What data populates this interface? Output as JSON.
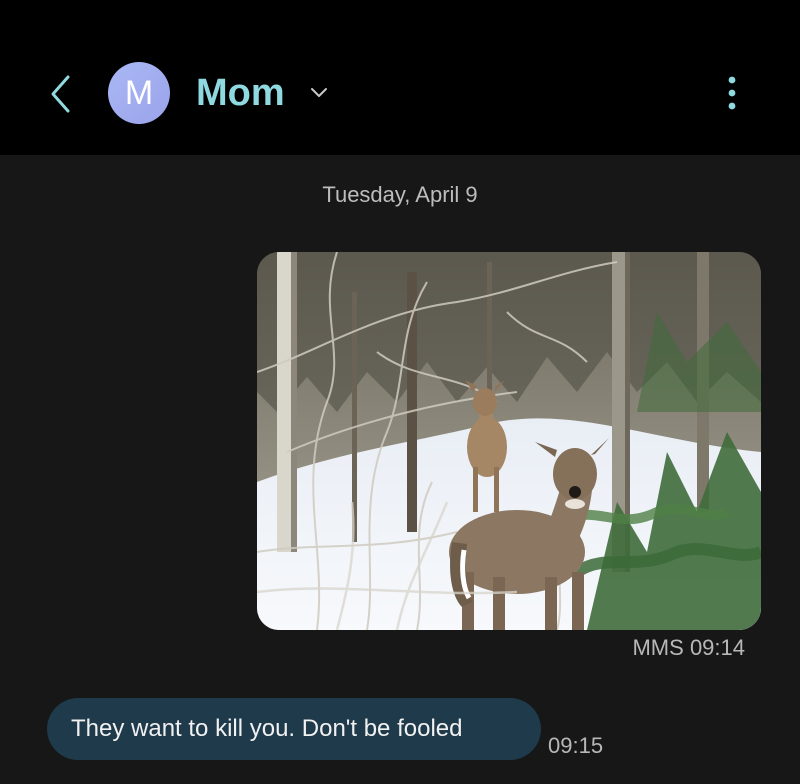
{
  "header": {
    "back_icon": "chevron-left-icon",
    "avatar_initial": "M",
    "contact_name": "Mom",
    "dropdown_icon": "chevron-down-icon",
    "more_icon": "more-vertical-icon",
    "accent_color": "#8fd9e0",
    "background_color": "#000000"
  },
  "conversation": {
    "date_separator": "Tuesday, April 9",
    "messages": [
      {
        "direction": "sent",
        "kind": "mms_image",
        "type_label": "MMS",
        "time": "09:14"
      },
      {
        "direction": "received",
        "kind": "text",
        "text": "They want to kill you. Don't be fooled",
        "time": "09:15",
        "bubble_color": "#1f3a4b"
      }
    ]
  },
  "colors": {
    "background": "#171717",
    "meta_text": "#b8b8b8"
  }
}
